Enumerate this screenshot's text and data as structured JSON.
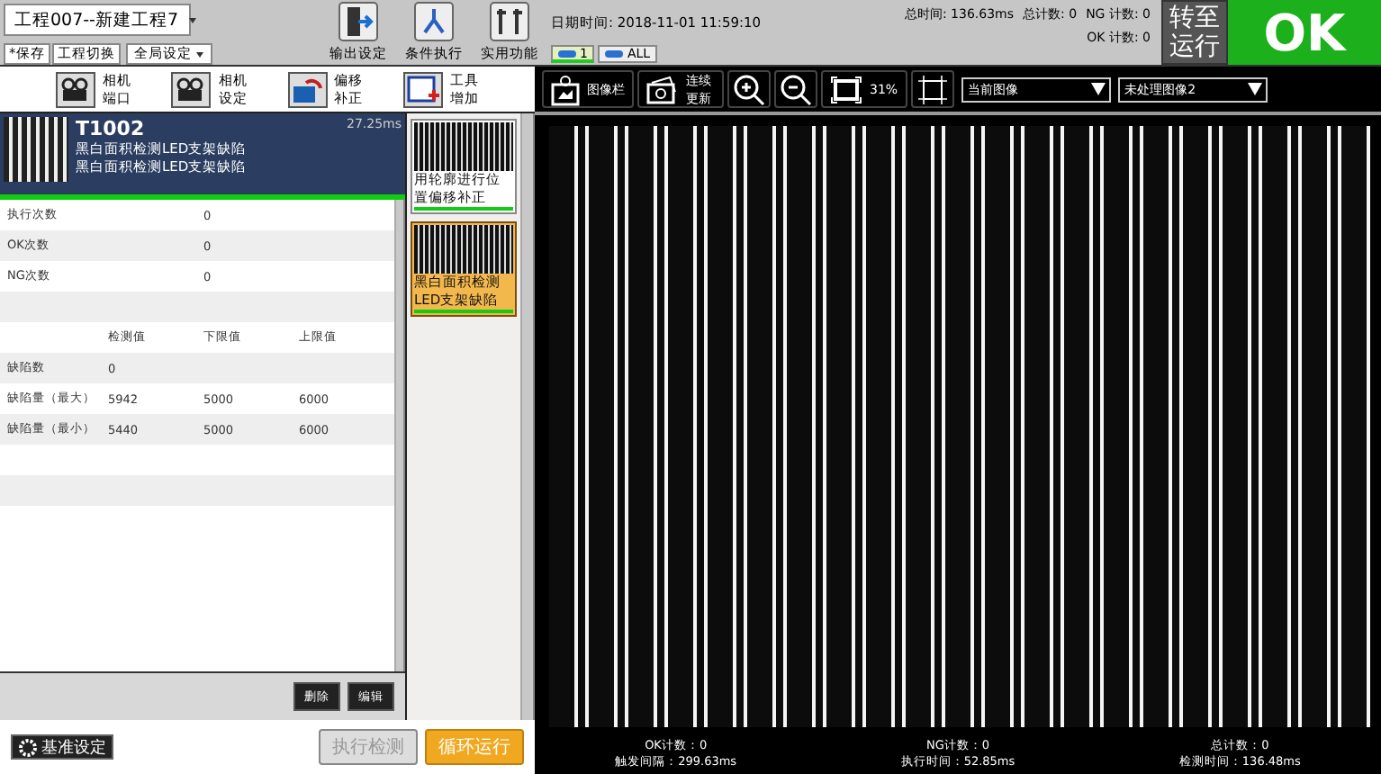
{
  "project_menu": {
    "label": "工程007--新建工程7"
  },
  "file_buttons": [
    "*保存",
    "工程切换"
  ],
  "global_settings": {
    "label": "全局设定"
  },
  "toolbar_buttons": [
    {
      "label": "输出设定",
      "kind": "output"
    },
    {
      "label": "条件执行",
      "kind": "condition"
    },
    {
      "label": "实用功能",
      "kind": "tools"
    }
  ],
  "datetime": "日期时间: 2018-11-01 11:59:10",
  "stats": {
    "total_time": "总时间: 136.63ms",
    "total_count": "总计数: 0",
    "ng_count": "NG 计数: 0",
    "ok_count": "OK 计数: 0"
  },
  "camera_tabs": [
    {
      "label": "1",
      "selected": true
    },
    {
      "label": "ALL",
      "selected": false
    }
  ],
  "run_button": "转至运行",
  "result": {
    "label": "OK",
    "kind": "ok"
  },
  "tool_buttons": [
    {
      "label": "相机端口",
      "kind": "camera"
    },
    {
      "label": "相机设定",
      "kind": "camera"
    },
    {
      "label": "偏移补正",
      "kind": "offset"
    },
    {
      "label": "工具增加",
      "kind": "add"
    }
  ],
  "image_toolbar": {
    "gallery": "图像栏",
    "continuous": "连续更新",
    "zoom": "31%",
    "source": "当前图像",
    "image": "未处理图像2"
  },
  "tool_detail": {
    "id": "T1002",
    "names": [
      "黑白面积检测LED支架缺陷",
      "黑白面积检测LED支架缺陷"
    ],
    "time": "27.25ms",
    "counts": [
      [
        "执行次数",
        "0"
      ],
      [
        "OK次数",
        "0"
      ],
      [
        "NG次数",
        "0"
      ]
    ],
    "columns": [
      "",
      "检测值",
      "下限值",
      "上限值"
    ],
    "rows": [
      [
        "缺陷数",
        "0",
        "",
        ""
      ],
      [
        "缺陷量（最大）",
        "5942",
        "5000",
        "6000"
      ],
      [
        "缺陷量（最小）",
        "5440",
        "5000",
        "6000"
      ]
    ],
    "buttons": [
      "删除",
      "编辑"
    ]
  },
  "tool_list": [
    {
      "label": "用轮廓进行位置偏移补正",
      "selected": false
    },
    {
      "label": "黑白面积检测LED支架缺陷",
      "selected": true
    }
  ],
  "bottom_buttons": {
    "reference": "基准设定",
    "execute": {
      "label": "执行检测",
      "disabled": true
    },
    "loop": "循环运行"
  },
  "status_bar": [
    "OK计数：0",
    "NG计数：0",
    "总计数：0",
    "触发间隔：299.63ms",
    "执行时间：52.85ms",
    "检测时间：136.48ms"
  ]
}
